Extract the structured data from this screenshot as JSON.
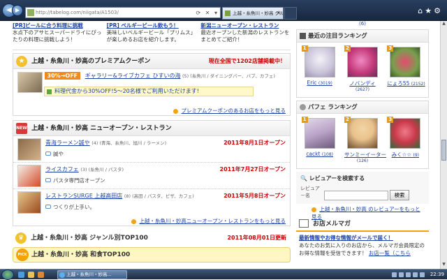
{
  "browser": {
    "address": "http://tabelog.com/niigata/A1503/",
    "tab_title": "上越・糸魚川・妙高 グル...",
    "addr_buttons": "⟳ ✕ ▾",
    "icons": [
      "home-icon",
      "star-icon",
      "gear-icon"
    ]
  },
  "pr": [
    {
      "title": "[PR]ビールに合う料理に挑戦",
      "body": "水点下のアサヒスーパードライにぴったりの料理に挑戦しよう！"
    },
    {
      "title": "[PR] ベルギービール飲もう！",
      "body": "美味しいベルギービール「プリムス」が楽しめるお店を紹介します。"
    },
    {
      "title": "新潟ニューオープン・レストラン",
      "body": "最近オープンした新潟のレストランをまとめてご紹介！"
    }
  ],
  "coupon": {
    "heading": "上越・糸魚川・妙高のプレミアムクーポン",
    "count_note": "現在全国で1202店舗掲載中！",
    "off_label": "30%→OFF",
    "shop_name": "ギャラリー&ライブカフェ ひすいの海",
    "shop_meta": "(5) (糸魚川 / ダイニングバー、バブ、カフェ)",
    "banner": "料理代金から30%OFF!5〜20名様でご利用いただけます!",
    "more": "プレミアムクーポンのあるお店をもっと見る"
  },
  "new_open": {
    "heading": "上越・糸魚川・妙高 ニューオープン・レストラン",
    "items": [
      {
        "name": "青海ラーメン誠や",
        "meta": "(4) (青海、糸魚川、旭川 / ラーメン)",
        "date": "2011年8月1日オープン",
        "comment": "誠や"
      },
      {
        "name": "ライスカフェ",
        "meta": "(3) (糸魚川 / パスタ)",
        "date": "2011年7月27日オープン",
        "comment": "パスタ専門店オープン"
      },
      {
        "name": "レストランSURGE 上越高田店",
        "meta": "(8) (高田 / パスタ、ピザ、カフェ)",
        "date": "2011年5月8日オープン",
        "comment": "つくりが上手い。"
      }
    ],
    "more": "上越・糸魚川・妙高ニューオープン・レストランをもっと見る"
  },
  "genre": {
    "heading": "上越・糸魚川・妙高 ジャンル別TOP100",
    "updated": "2011年08月01日更新",
    "pick_label": "PICK UP",
    "bar": "上越・糸魚川・妙高 和食TOP100"
  },
  "sidebar": {
    "top_count": "(6)",
    "ranking_title": "最近の注目ランキング",
    "ranking": [
      {
        "rank": "1",
        "name": "Eric",
        "count": "(3019)",
        "color": "#c9c3d8"
      },
      {
        "rank": "2",
        "name": "ノバンディ",
        "count": "(2627)",
        "color": "#c43a7a"
      },
      {
        "rank": "3",
        "name": "にょろ55",
        "count": "(2152)",
        "color": "#7a9e4e"
      }
    ],
    "parfait_title": "パフェ ランキング",
    "parfait": [
      {
        "rank": "1",
        "name": "cackt",
        "count": "(108)",
        "color": "#b9a3c6"
      },
      {
        "rank": "2",
        "name": "サンミーイーター",
        "count": "(126)",
        "color": "#e8c28a"
      },
      {
        "rank": "3",
        "name": "みく☆☆",
        "count": "(9)",
        "color": "#c8394a"
      }
    ],
    "search_title": "レビュアーを検索する",
    "search_prefix": "レビュア－名",
    "search_placeholder": "",
    "search_button": "検索",
    "reviewer_more": "上越・糸魚川・妙高 のレビュアーをもっと見る",
    "mail_title": "お店メルマガ",
    "mail_lead": "最新情報やお得な情報がメールで届く！",
    "mail_body": "あなたのお気に入りのお店から、メルマガ会員限定のお得な情報を受信できます！",
    "mail_link": "お店一覧（こちら"
  },
  "taskbar": {
    "task_label": "上越・糸魚川・妙高...",
    "clock": "22:39"
  }
}
